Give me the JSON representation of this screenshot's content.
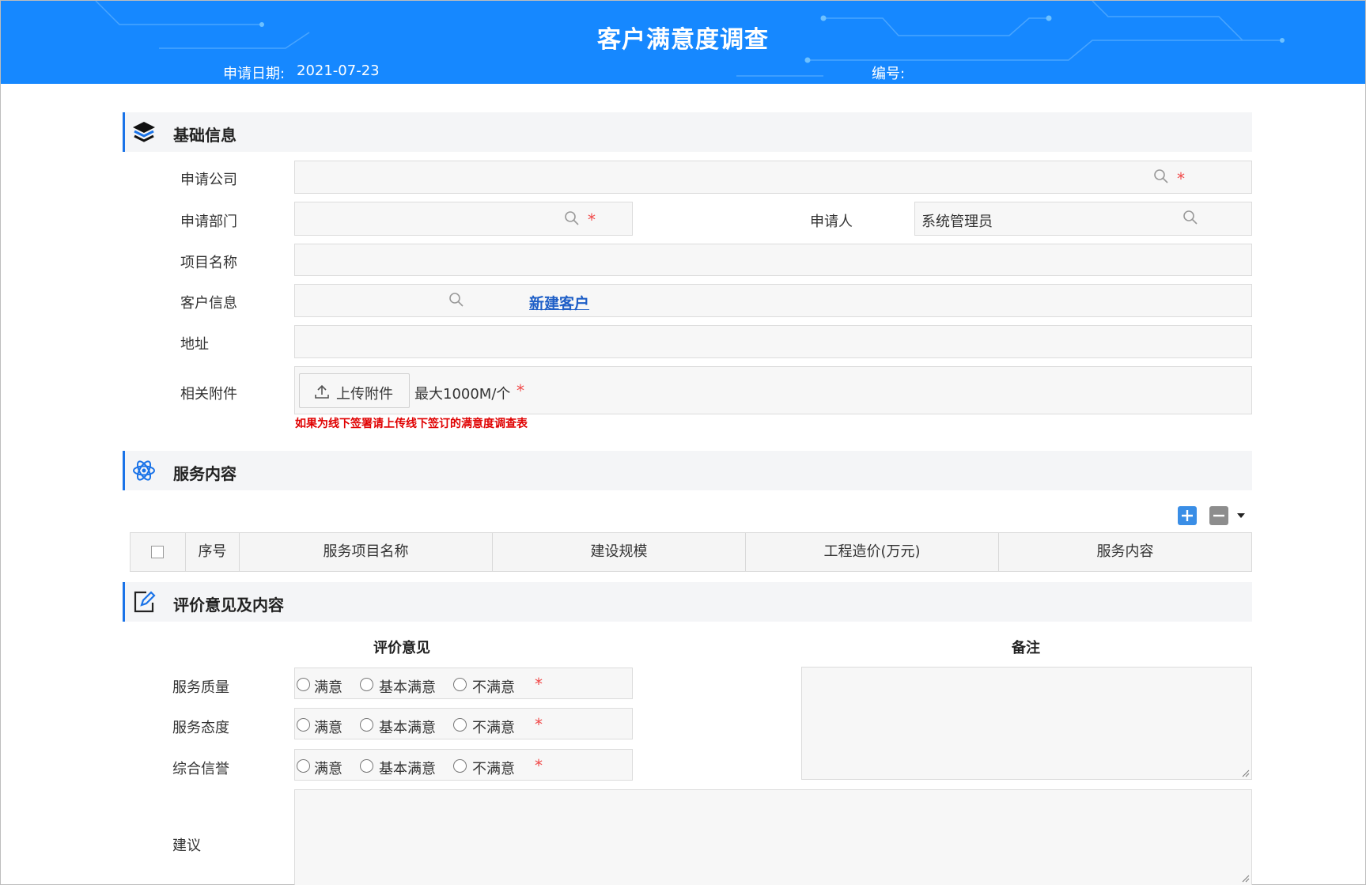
{
  "header": {
    "title": "客户满意度调查",
    "apply_date_label": "申请日期:",
    "apply_date_value": "2021-07-23",
    "serial_label": "编号:"
  },
  "sections": {
    "basic": "基础信息",
    "service": "服务内容",
    "evaluation": "评价意见及内容"
  },
  "basic_form": {
    "company_label": "申请公司",
    "department_label": "申请部门",
    "applicant_label": "申请人",
    "applicant_value": "系统管理员",
    "project_label": "项目名称",
    "customer_label": "客户信息",
    "new_customer_link": "新建客户",
    "address_label": "地址",
    "attachment_label": "相关附件",
    "upload_button": "上传附件",
    "upload_hint": "最大1000M/个",
    "required_mark": "*",
    "offline_note": "如果为线下签署请上传线下签订的满意度调查表"
  },
  "service_table": {
    "columns": [
      "序号",
      "服务项目名称",
      "建设规模",
      "工程造价(万元)",
      "服务内容"
    ]
  },
  "evaluation": {
    "opinion_heading": "评价意见",
    "remarks_heading": "备注",
    "rows": [
      {
        "label": "服务质量"
      },
      {
        "label": "服务态度"
      },
      {
        "label": "综合信誉"
      }
    ],
    "options": [
      "满意",
      "基本满意",
      "不满意"
    ],
    "suggestion_label": "建议"
  },
  "colors": {
    "header_blue": "#1688ff",
    "accent": "#1a73e8",
    "required": "#f04848",
    "note_red": "#e00000",
    "link": "#1f5fc7"
  }
}
